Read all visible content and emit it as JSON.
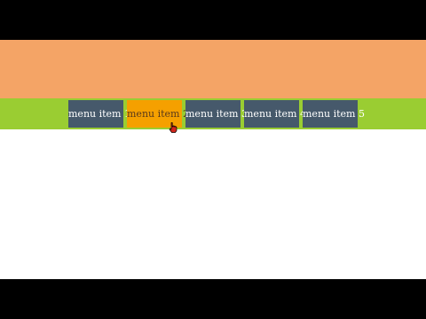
{
  "nav": {
    "items": [
      {
        "label": "menu item 1"
      },
      {
        "label": "menu item 2"
      },
      {
        "label": "menu item 3"
      },
      {
        "label": "menu item 4"
      },
      {
        "label": "menu item 5"
      }
    ],
    "active_index": 1
  },
  "colors": {
    "header": "#f4a466",
    "nav_bar": "#9acd32",
    "menu_item": "#46596b",
    "menu_item_active": "#f5a000",
    "background": "#ffffff",
    "letterbox": "#000000"
  },
  "cursor": {
    "icon": "hand-pointer-icon"
  }
}
